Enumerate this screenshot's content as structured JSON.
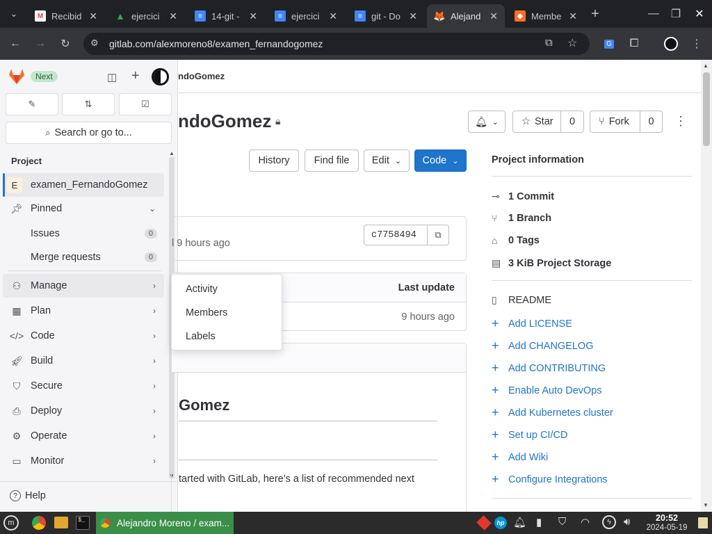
{
  "browser": {
    "tabs": [
      {
        "title": "Recibid",
        "favicon": "gmail-icon",
        "color": "#ea4335"
      },
      {
        "title": "ejercici",
        "favicon": "google-drive-icon",
        "color": "#34a853"
      },
      {
        "title": "14-git -",
        "favicon": "google-docs-icon",
        "color": "#4285f4"
      },
      {
        "title": "ejercici",
        "favicon": "google-docs-icon",
        "color": "#4285f4"
      },
      {
        "title": "git - Do",
        "favicon": "google-docs-icon",
        "color": "#4285f4"
      },
      {
        "title": "Alejand",
        "favicon": "gitlab-icon",
        "color": "#fc6d26",
        "active": true
      },
      {
        "title": "Membe",
        "favicon": "gitlab-icon",
        "color": "#fc6d26"
      }
    ],
    "url": "gitlab.com/alexmoreno8/examen_fernandogomez"
  },
  "sidebar": {
    "next_badge": "Next",
    "search_placeholder": "Search or go to...",
    "section_label": "Project",
    "project_initial": "E",
    "project_name": "examen_FernandoGomez",
    "pinned_label": "Pinned",
    "issues_label": "Issues",
    "issues_count": "0",
    "mr_label": "Merge requests",
    "mr_count": "0",
    "items": [
      "Manage",
      "Plan",
      "Code",
      "Build",
      "Secure",
      "Deploy",
      "Operate",
      "Monitor"
    ],
    "help_label": "Help"
  },
  "flyout": {
    "items": [
      "Activity",
      "Members",
      "Labels"
    ]
  },
  "main": {
    "breadcrumb_tail": "ndoGomez",
    "project_title": "ndoGomez",
    "star_label": "Star",
    "star_count": "0",
    "fork_label": "Fork",
    "fork_count": "0",
    "history_label": "History",
    "find_file_label": "Find file",
    "edit_label": "Edit",
    "code_label": "Code",
    "commit_time": "l 9 hours ago",
    "commit_sha": "c7758494",
    "last_update_header": "Last update",
    "file_time": "9 hours ago",
    "readme_heading": "Gomez",
    "readme_text": "tarted with GitLab, here's a list of recommended next"
  },
  "project_info": {
    "heading": "Project information",
    "stats": [
      {
        "icon": "commit-icon",
        "label": "1 Commit"
      },
      {
        "icon": "branch-icon",
        "label": "1 Branch"
      },
      {
        "icon": "tag-icon",
        "label": "0 Tags"
      },
      {
        "icon": "storage-icon",
        "label": "3 KiB Project Storage"
      }
    ],
    "readme_label": "README",
    "links": [
      "Add LICENSE",
      "Add CHANGELOG",
      "Add CONTRIBUTING",
      "Enable Auto DevOps",
      "Add Kubernetes cluster",
      "Set up CI/CD",
      "Add Wiki",
      "Configure Integrations"
    ]
  },
  "taskbar": {
    "window_title": "Alejandro Moreno / exam...",
    "time": "20:52",
    "date": "2024-05-19"
  }
}
